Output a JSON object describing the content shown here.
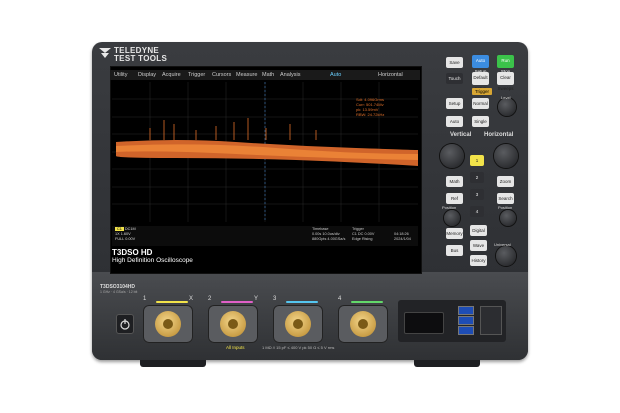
{
  "device": {
    "brand_line1": "TELEDYNE",
    "brand_line2": "TEST TOOLS",
    "model": "T3DSO3104HD",
    "model_sub": "1 GHz · 4 GSa/s · 12 bit",
    "screen_title": "T3DSO HD",
    "screen_subtitle": "High Definition Oscilloscope",
    "bottom_note": "1 MΩ // 15 pF ≤ 400 V pk   50 Ω ≤ 5 V rms",
    "all_inputs": "All Inputs"
  },
  "menu": {
    "items": [
      "Utility",
      "Display",
      "Acquire",
      "Trigger",
      "Cursors",
      "Measure",
      "Math",
      "Analysis"
    ],
    "right_label": "Horizontal",
    "auto_label": "Auto"
  },
  "screen": {
    "readouts": [
      "Sdt: 4.096Grms",
      "Curr: 501.74Mv",
      "pk: 13.59mV",
      "RBW: 24.72kHz"
    ],
    "ch_info": [
      "C1",
      "DC1M",
      "1X",
      "1.60V",
      "FULL",
      "0.00V"
    ],
    "timebase_label": "Timebase",
    "timebase": [
      "0.00s",
      "10.0us/div",
      "880Gpts",
      "4.00GSa/s"
    ],
    "trigger_label": "Trigger",
    "trigger": [
      "C1 DC",
      "0.00V",
      "Edge",
      "Rising"
    ],
    "time": "04:18:26",
    "date": "2024/1/04"
  },
  "panel": {
    "row1": [
      "Save",
      "Auto Setup",
      "Run Stop"
    ],
    "row2": [
      "Touch",
      "Default Setup",
      "Clear Sweeps"
    ],
    "trigger_label": "Trigger",
    "trig_buttons": [
      "Setup",
      "Normal",
      "Auto",
      "Single"
    ],
    "trig_knob": "Level",
    "vertical_label": "Vertical",
    "horizontal_label": "Horizontal",
    "channels": [
      "1",
      "2",
      "3",
      "4"
    ],
    "left_col": [
      "Math",
      "Ref",
      "Memory",
      "Bus"
    ],
    "right_col": [
      "Zoom",
      "Search",
      "Digital",
      "Wave Gen"
    ],
    "history": "History",
    "universal": "Universal",
    "knob_labels": [
      "Position",
      "Scale",
      "Position",
      "Scale"
    ]
  },
  "inputs": {
    "channels": [
      {
        "num": "1",
        "suffix": "X",
        "color": "#f2e34a"
      },
      {
        "num": "2",
        "suffix": "Y",
        "color": "#e060c8"
      },
      {
        "num": "3",
        "suffix": "",
        "color": "#55c6f0"
      },
      {
        "num": "4",
        "suffix": "",
        "color": "#63d86a"
      }
    ]
  },
  "colors": {
    "trace": "#e0702a",
    "body": "#33353a"
  }
}
